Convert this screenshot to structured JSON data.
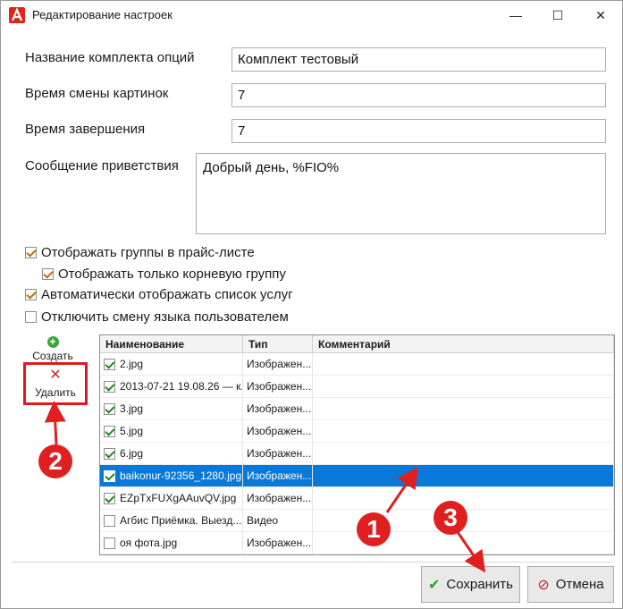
{
  "window": {
    "title": "Редактирование настроек",
    "min_glyph": "—",
    "max_glyph": "☐",
    "close_glyph": "✕"
  },
  "form": {
    "set_name_label": "Название комплекта опций",
    "set_name_value": "Комплект тестовый",
    "change_time_label": "Время смены картинок",
    "change_time_value": "7",
    "finish_time_label": "Время завершения",
    "finish_time_value": "7",
    "greeting_label": "Сообщение приветствия",
    "greeting_value": "Добрый день, %FIO%"
  },
  "options": [
    {
      "label": "Отображать группы в прайс-листе",
      "checked": true
    },
    {
      "label": "Отображать только корневую группу",
      "checked": true
    },
    {
      "label": "Автоматически отображать список услуг",
      "checked": true
    },
    {
      "label": "Отключить смену языка пользователем",
      "checked": false
    }
  ],
  "tools": {
    "create_label": "Создать",
    "delete_label": "Удалить",
    "delete_glyph": "✕",
    "create_glyph": "+"
  },
  "grid": {
    "columns": [
      "Наименование",
      "Тип",
      "Комментарий"
    ],
    "rows": [
      {
        "name": "2.jpg",
        "type": "Изображен...",
        "comment": "",
        "checked": true
      },
      {
        "name": "2013-07-21 19.08.26 — к...",
        "type": "Изображен...",
        "comment": "",
        "checked": true
      },
      {
        "name": "3.jpg",
        "type": "Изображен...",
        "comment": "",
        "checked": true
      },
      {
        "name": "5.jpg",
        "type": "Изображен...",
        "comment": "",
        "checked": true
      },
      {
        "name": "6.jpg",
        "type": "Изображен...",
        "comment": "",
        "checked": true
      },
      {
        "name": "baikonur-92356_1280.jpg",
        "type": "Изображен...",
        "comment": "",
        "checked": true
      },
      {
        "name": "EZpTxFUXgAAuvQV.jpg",
        "type": "Изображен...",
        "comment": "",
        "checked": true
      },
      {
        "name": "Агбис Приёмка. Выезд...",
        "type": "Видео",
        "comment": "",
        "checked": false
      },
      {
        "name": "оя фота.jpg",
        "type": "Изображен...",
        "comment": "",
        "checked": false
      }
    ],
    "selected_index": 5
  },
  "buttons": {
    "save_label": "Сохранить",
    "save_glyph": "✔",
    "cancel_label": "Отмена",
    "cancel_glyph": "⊘"
  },
  "annotations": {
    "one": "1",
    "two": "2",
    "three": "3",
    "color": "#e02020"
  },
  "colors": {
    "selection": "#0a78d7",
    "annotation_red": "#e02020"
  }
}
